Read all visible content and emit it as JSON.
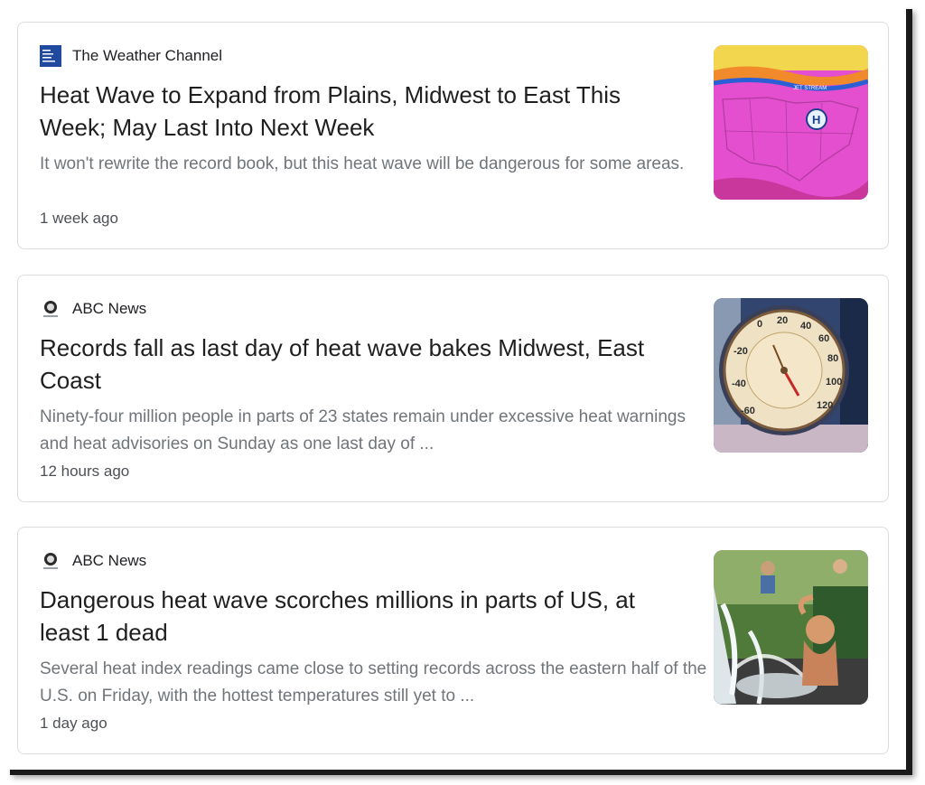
{
  "articles": [
    {
      "source": "The Weather Channel",
      "source_icon": "weather-channel-logo-icon",
      "headline": "Heat Wave to Expand from Plains, Midwest to East This Week; May Last Into Next Week",
      "snippet": "It won't rewrite the record book, but this heat wave will be dangerous for some areas.",
      "time": "1 week ago",
      "thumbnail": "heat-map-thumbnail"
    },
    {
      "source": "ABC News",
      "source_icon": "abc-news-logo-icon",
      "headline": "Records fall as last day of heat wave bakes Midwest, East Coast",
      "snippet": "Ninety-four million people in parts of 23 states remain under excessive heat warnings and heat advisories on Sunday as one last day of ...",
      "time": "12 hours ago",
      "thumbnail": "thermometer-thumbnail"
    },
    {
      "source": "ABC News",
      "source_icon": "abc-news-logo-icon",
      "headline": "Dangerous heat wave scorches millions in parts of US, at least 1 dead",
      "snippet": "Several heat index readings came close to setting records across the eastern half of the U.S. on Friday, with the hottest temperatures still yet to ...",
      "time": "1 day ago",
      "thumbnail": "fountain-child-thumbnail"
    }
  ],
  "thumb_texts": {
    "jet_stream": "JET STREAM",
    "high": "H",
    "gauge_ticks": [
      "0",
      "20",
      "40",
      "60",
      "80",
      "100",
      "120",
      "-20",
      "-40",
      "-60"
    ]
  },
  "colors": {
    "headline": "#1f1f1f",
    "snippet": "#70757a",
    "time": "#4d5156",
    "border": "#dadce0",
    "weather_channel_blue": "#1f4aa0"
  }
}
